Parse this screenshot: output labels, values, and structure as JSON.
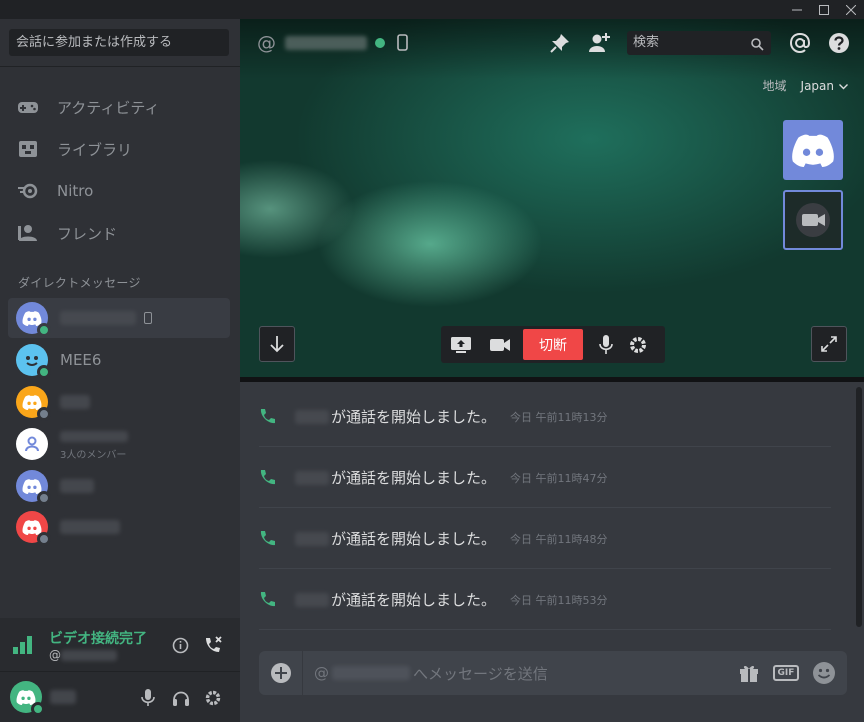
{
  "window": {
    "controls": [
      "minimize",
      "maximize",
      "close"
    ]
  },
  "sidebar": {
    "search_placeholder": "会話に参加または作成する",
    "nav": [
      {
        "label": "アクティビティ",
        "icon": "gamepad-icon"
      },
      {
        "label": "ライブラリ",
        "icon": "library-icon"
      },
      {
        "label": "Nitro",
        "icon": "nitro-icon"
      },
      {
        "label": "フレンド",
        "icon": "friends-icon"
      }
    ],
    "dm_header": "ダイレクトメッセージ",
    "dms": [
      {
        "name": "",
        "avatar_color": "#7289da",
        "status": "online",
        "device": "mobile-icon",
        "active": true
      },
      {
        "name": "MEE6",
        "avatar_color": "#5cc2ef",
        "status": "online"
      },
      {
        "name": "",
        "avatar_color": "#faa61a",
        "status": "offline"
      },
      {
        "name": "",
        "subtitle": "3人のメンバー",
        "avatar_color": "#ffffff",
        "status": "group"
      },
      {
        "name": "",
        "avatar_color": "#7289da",
        "status": "offline"
      },
      {
        "name": "",
        "avatar_color": "#f04747",
        "status": "offline"
      }
    ],
    "voice": {
      "title": "ビデオ接続完了",
      "channel_prefix": "@"
    }
  },
  "header": {
    "at_symbol": "@",
    "search_placeholder": "検索",
    "region_label": "地域",
    "region_value": "Japan"
  },
  "call": {
    "hangup_label": "切断"
  },
  "messages": [
    {
      "text": "が通話を開始しました。",
      "time": "今日 午前11時13分"
    },
    {
      "text": "が通話を開始しました。",
      "time": "今日 午前11時47分"
    },
    {
      "text": "が通話を開始しました。",
      "time": "今日 午前11時48分"
    },
    {
      "text": "が通話を開始しました。",
      "time": "今日 午前11時53分"
    }
  ],
  "composer": {
    "prefix": "@",
    "placeholder_suffix": "へメッセージを送信",
    "gif_label": "GIF"
  },
  "colors": {
    "accent": "#7289da",
    "online": "#43b581",
    "danger": "#f04747",
    "sidebar_bg": "#2f3136",
    "main_bg": "#36393f"
  }
}
